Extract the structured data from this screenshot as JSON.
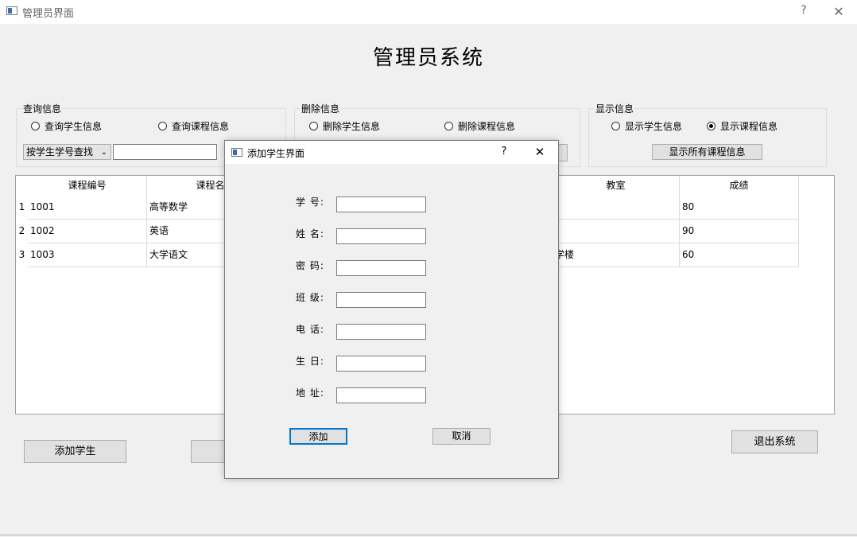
{
  "window": {
    "title": "管理员界面",
    "help": "?",
    "close": "✕"
  },
  "main_title": "管理员系统",
  "query_group": {
    "title": "查询信息",
    "radio_student": "查询学生信息",
    "radio_course": "查询课程信息",
    "combo_value": "按学生学号查找",
    "search_value": ""
  },
  "delete_group": {
    "title": "删除信息",
    "radio_student": "删除学生信息",
    "radio_course": "删除课程信息"
  },
  "show_group": {
    "title": "显示信息",
    "radio_student": "显示学生信息",
    "radio_course": "显示课程信息",
    "selected": "radio_course",
    "button": "显示所有课程信息"
  },
  "table": {
    "columns": [
      "课程编号",
      "课程名",
      "",
      "",
      "教室",
      "成绩"
    ],
    "rows": [
      {
        "num": "1",
        "cells": [
          "1001",
          "高等数学",
          "",
          "",
          "",
          "80"
        ]
      },
      {
        "num": "2",
        "cells": [
          "1002",
          "英语",
          "",
          "",
          "",
          "90"
        ]
      },
      {
        "num": "3",
        "cells": [
          "1003",
          "大学语文",
          "",
          "",
          "学楼",
          "60"
        ]
      }
    ]
  },
  "bottom": {
    "add_student": "添加学生",
    "exit": "退出系统"
  },
  "dialog": {
    "title": "添加学生界面",
    "help": "?",
    "close": "✕",
    "fields": [
      {
        "label": "学 号:",
        "value": ""
      },
      {
        "label": "姓 名:",
        "value": ""
      },
      {
        "label": "密 码:",
        "value": ""
      },
      {
        "label": "班 级:",
        "value": ""
      },
      {
        "label": "电 话:",
        "value": ""
      },
      {
        "label": "生 日:",
        "value": ""
      },
      {
        "label": "地 址:",
        "value": ""
      }
    ],
    "add": "添加",
    "cancel": "取消"
  }
}
